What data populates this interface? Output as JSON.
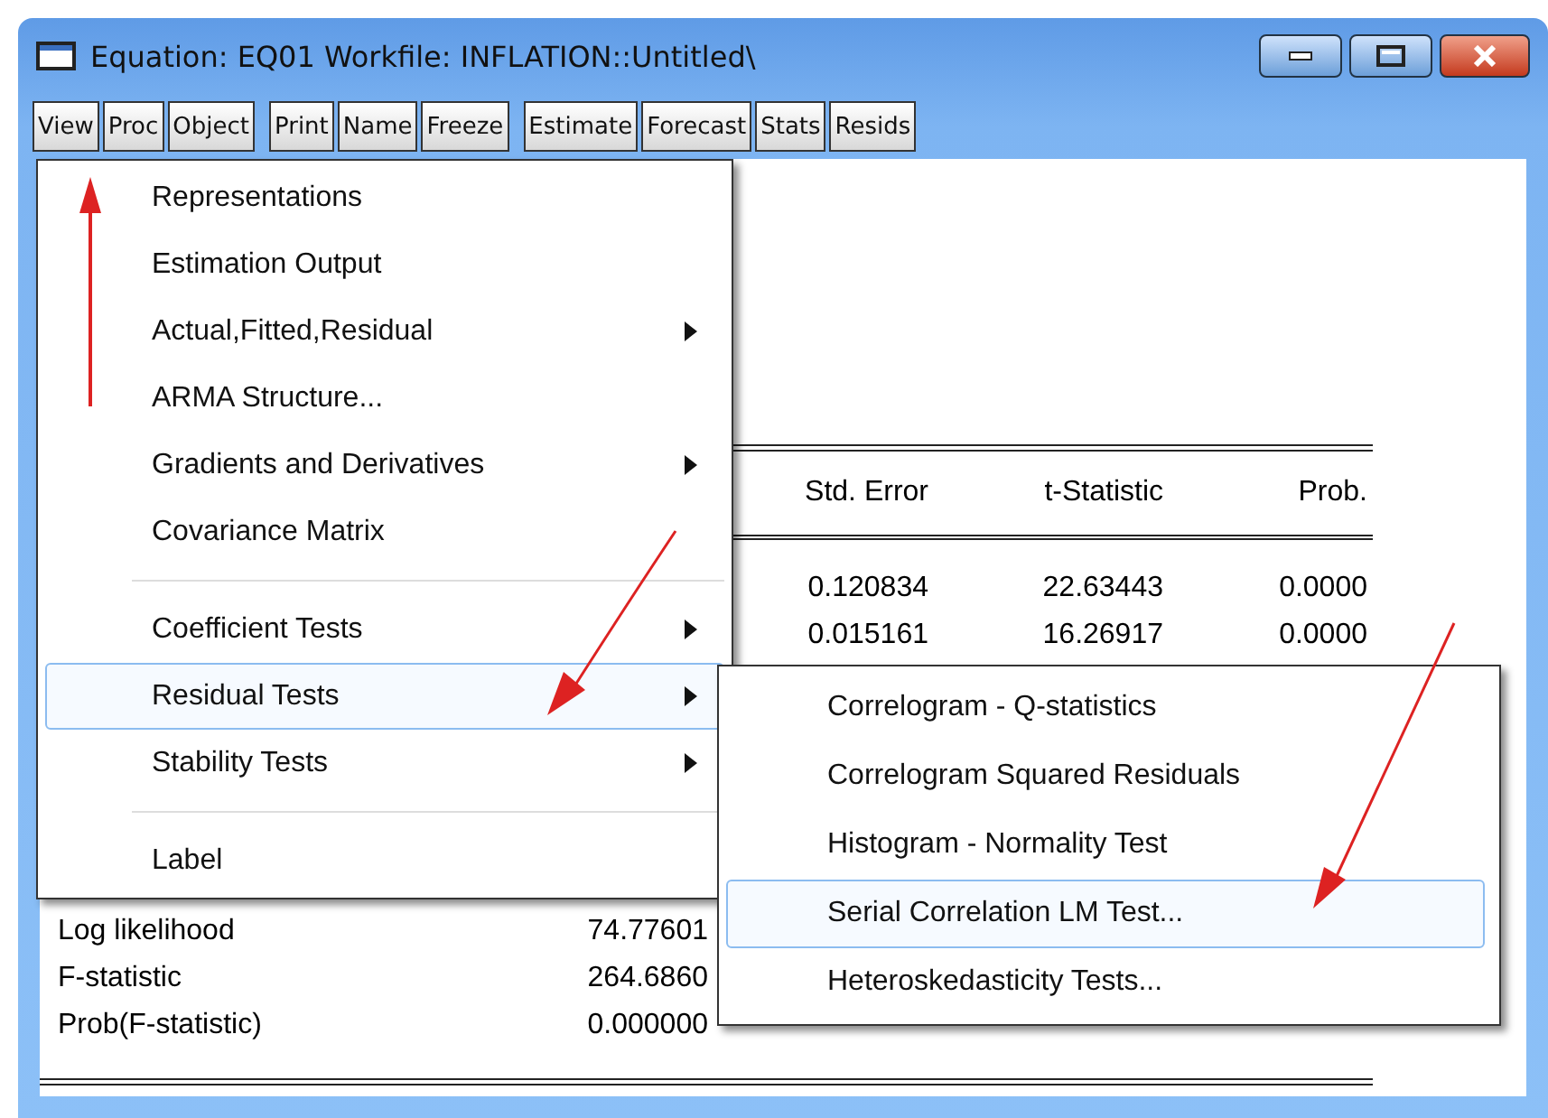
{
  "window": {
    "title": "Equation: EQ01   Workfile: INFLATION::Untitled\\"
  },
  "toolbar": [
    [
      {
        "label": "View"
      },
      {
        "label": "Proc"
      },
      {
        "label": "Object"
      }
    ],
    [
      {
        "label": "Print"
      },
      {
        "label": "Name"
      },
      {
        "label": "Freeze"
      }
    ],
    [
      {
        "label": "Estimate"
      },
      {
        "label": "Forecast"
      },
      {
        "label": "Stats"
      },
      {
        "label": "Resids"
      }
    ]
  ],
  "table": {
    "columns": [
      "Std. Error",
      "t-Statistic",
      "Prob."
    ],
    "rows": [
      [
        "0.120834",
        "22.63443",
        "0.0000"
      ],
      [
        "0.015161",
        "16.26917",
        "0.0000"
      ]
    ]
  },
  "statistics": [
    {
      "label": "Log likelihood",
      "value": "74.77601"
    },
    {
      "label": "F-statistic",
      "value": "264.6860"
    },
    {
      "label": "Prob(F-statistic)",
      "value": "0.000000"
    }
  ],
  "view_menu": [
    {
      "kind": "item",
      "label": "Representations",
      "has_submenu": false,
      "selected": false
    },
    {
      "kind": "item",
      "label": "Estimation Output",
      "has_submenu": false,
      "selected": false
    },
    {
      "kind": "item",
      "label": "Actual,Fitted,Residual",
      "has_submenu": true,
      "selected": false
    },
    {
      "kind": "item",
      "label": "ARMA Structure...",
      "has_submenu": false,
      "selected": false
    },
    {
      "kind": "item",
      "label": "Gradients and Derivatives",
      "has_submenu": true,
      "selected": false
    },
    {
      "kind": "item",
      "label": "Covariance Matrix",
      "has_submenu": false,
      "selected": false
    },
    {
      "kind": "separator"
    },
    {
      "kind": "item",
      "label": "Coefficient Tests",
      "has_submenu": true,
      "selected": false
    },
    {
      "kind": "item",
      "label": "Residual Tests",
      "has_submenu": true,
      "selected": true
    },
    {
      "kind": "item",
      "label": "Stability Tests",
      "has_submenu": true,
      "selected": false
    },
    {
      "kind": "separator"
    },
    {
      "kind": "item",
      "label": "Label",
      "has_submenu": false,
      "selected": false
    }
  ],
  "residual_tests_menu": [
    {
      "label": "Correlogram - Q-statistics",
      "selected": false
    },
    {
      "label": "Correlogram Squared Residuals",
      "selected": false
    },
    {
      "label": "Histogram - Normality Test",
      "selected": false
    },
    {
      "label": "Serial Correlation LM Test...",
      "selected": true
    },
    {
      "label": "Heteroskedasticity Tests...",
      "selected": false
    }
  ]
}
